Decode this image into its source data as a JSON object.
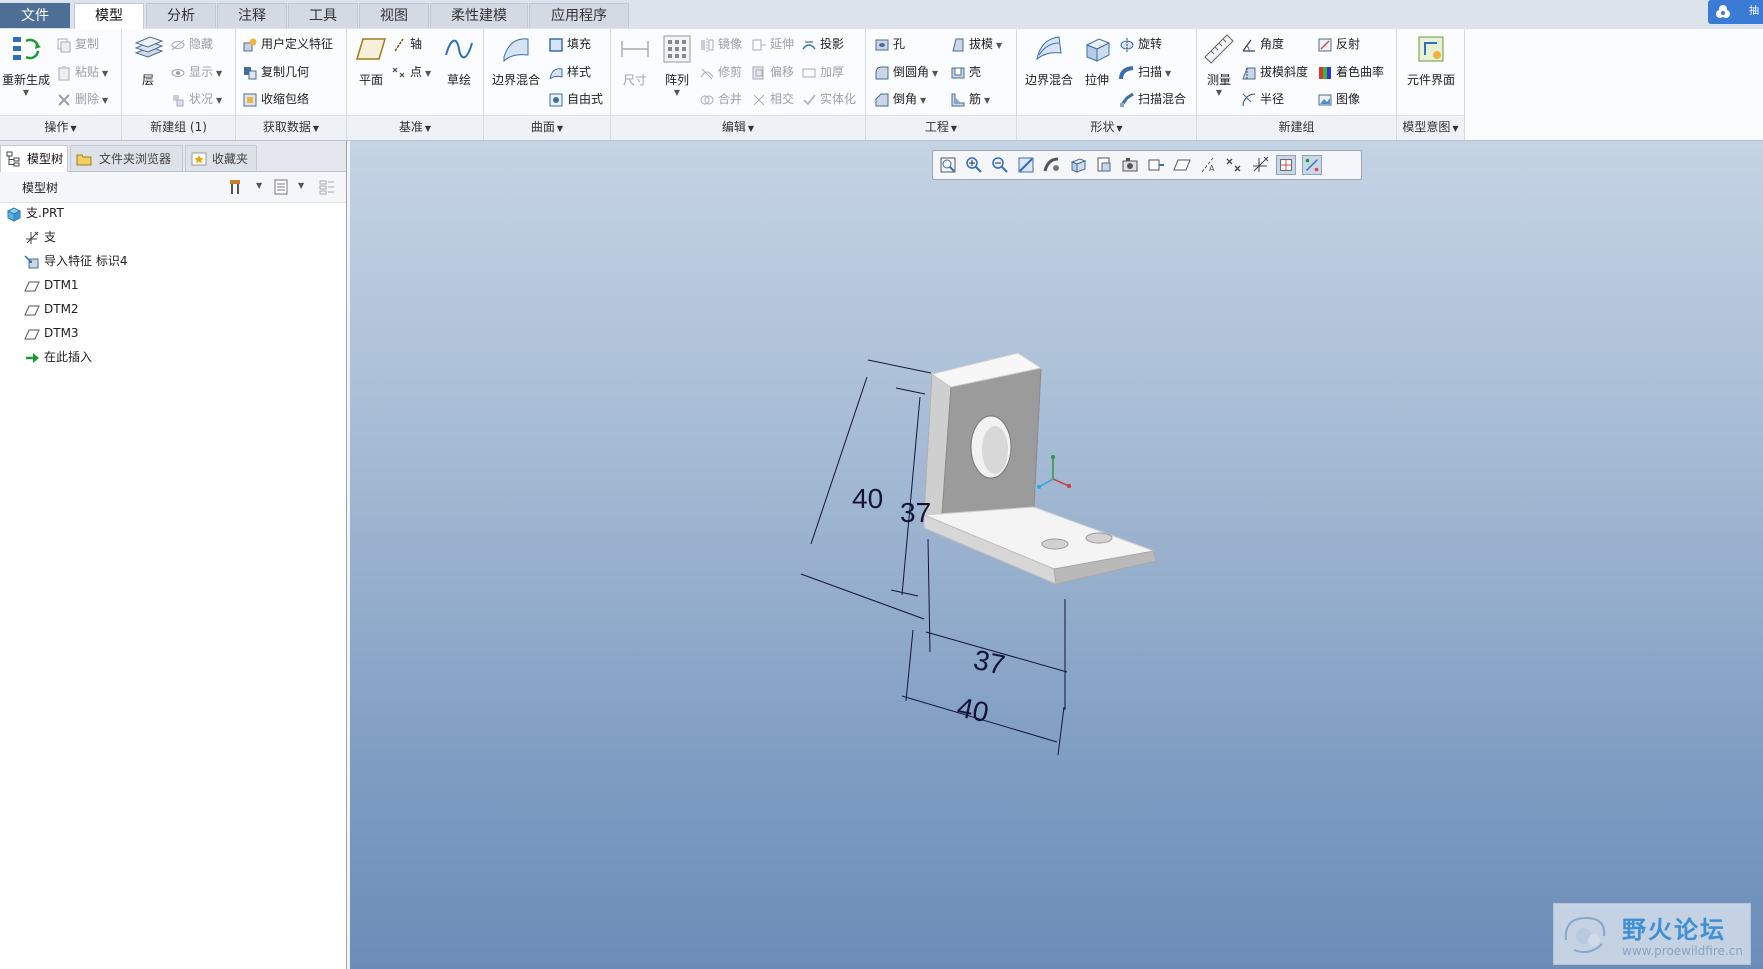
{
  "tabs": [
    "文件",
    "模型",
    "分析",
    "注释",
    "工具",
    "视图",
    "柔性建模",
    "应用程序"
  ],
  "corner_button_label": "抽",
  "ribbon": {
    "operations": {
      "footer": "操作",
      "regenerate": "重新生成",
      "copy": "复制",
      "paste": "粘贴",
      "delete": "删除"
    },
    "newgroup": {
      "footer": "新建组 (1)",
      "layer": "层",
      "hide": "隐藏",
      "show": "显示",
      "status": "状况"
    },
    "getdata": {
      "footer": "获取数据",
      "udf": "用户定义特征",
      "copy_geom": "复制几何",
      "shrinkwrap": "收缩包络"
    },
    "datum": {
      "footer": "基准",
      "plane": "平面",
      "axis": "轴",
      "point": "点",
      "sketch": "草绘"
    },
    "surfaces": {
      "footer": "曲面",
      "boundary_blend": "边界混合",
      "fill": "填充",
      "style": "样式",
      "freestyle": "自由式"
    },
    "editing": {
      "footer": "编辑",
      "dimension": "尺寸",
      "pattern": "阵列",
      "mirror": "镜像",
      "trim": "修剪",
      "merge": "合并",
      "extend": "延伸",
      "offset": "偏移",
      "intersect": "相交",
      "project": "投影",
      "thicken": "加厚",
      "solidify": "实体化"
    },
    "engineering": {
      "footer": "工程",
      "hole": "孔",
      "round": "倒圆角",
      "chamfer": "倒角",
      "draft": "拔模",
      "shell": "壳",
      "rib": "筋"
    },
    "shapes": {
      "footer": "形状",
      "boundary_blend": "边界混合",
      "extrude": "拉伸",
      "revolve": "旋转",
      "sweep": "扫描",
      "swept_blend": "扫描混合"
    },
    "newgroup2": {
      "footer": "新建组",
      "measure": "测量",
      "angle": "角度",
      "draft_slope": "拔模斜度",
      "radius": "半径",
      "reflection": "反射",
      "shaded_curvature": "着色曲率",
      "image": "图像"
    },
    "intent": {
      "footer": "模型意图",
      "component_interface": "元件界面"
    }
  },
  "navigator": {
    "tabs": [
      "模型树",
      "文件夹浏览器",
      "收藏夹"
    ],
    "tree_title": "模型树",
    "items": [
      "支.PRT",
      "支",
      "导入特征 标识4",
      "DTM1",
      "DTM2",
      "DTM3",
      "在此插入"
    ]
  },
  "dimensions": {
    "vertical_outer": "40",
    "vertical_inner": "37",
    "horizontal_inner": "37",
    "horizontal_outer": "40"
  },
  "watermark": {
    "title": "野火论坛",
    "url": "www.proewildfire.cn"
  },
  "colors": {
    "file_tab": "#4d6f95",
    "viewport_top": "#c5d4e4",
    "viewport_bottom": "#6b8db8",
    "dimension_text": "#14143a",
    "part_face": "#e8e8e8"
  }
}
